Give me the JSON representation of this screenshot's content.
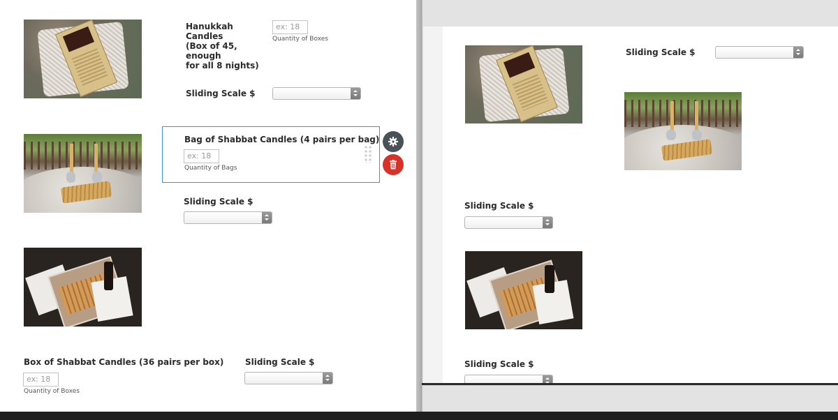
{
  "left_form": {
    "hanukkah": {
      "title": "Hanukkah Candles\n(Box of 45, enough\nfor all 8 nights)",
      "quantity_placeholder": "ex: 18",
      "quantity_hint": "Quantity of Boxes",
      "sliding_scale_label": "Sliding Scale $"
    },
    "shabbat_bag": {
      "title": "Bag of Shabbat Candles (4 pairs per bag)",
      "quantity_placeholder": "ex: 18",
      "quantity_hint": "Quantity of Bags",
      "sliding_scale_label": "Sliding Scale $"
    },
    "shabbat_box": {
      "title": "Box of Shabbat Candles (36 pairs per box)",
      "quantity_placeholder": "ex: 18",
      "quantity_hint": "Quantity of Boxes",
      "sliding_scale_label": "Sliding Scale $"
    }
  },
  "field_tools": {
    "settings_icon": "gear-icon",
    "delete_icon": "trash-icon",
    "drag_icon": "drag-handle-icon"
  },
  "preview": {
    "sliding_scale_label_1": "Sliding Scale $",
    "sliding_scale_label_2": "Sliding Scale $",
    "sliding_scale_label_3": "Sliding Scale $"
  },
  "colors": {
    "selection_border": "#3e8fe0",
    "delete_button": "#d6322a",
    "settings_button": "#4b5159"
  }
}
